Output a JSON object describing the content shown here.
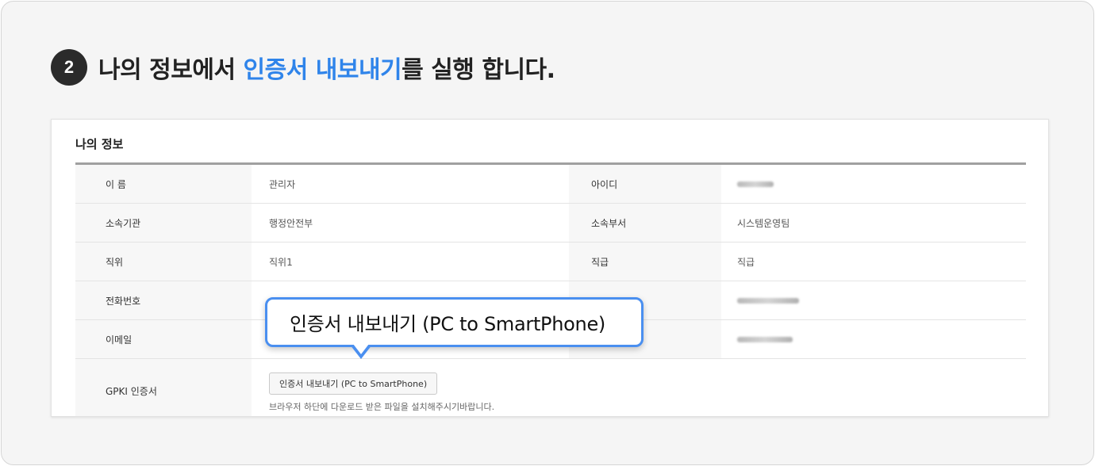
{
  "step": {
    "number": "2",
    "text_before": "나의 정보에서 ",
    "highlight": "인증서 내보내기",
    "text_after": "를 실행 합니다."
  },
  "card": {
    "title": "나의 정보",
    "rows": [
      {
        "label": "이 름",
        "value": "관리자",
        "label2": "아이디",
        "value2": ""
      },
      {
        "label": "소속기관",
        "value": "행정안전부",
        "label2": "소속부서",
        "value2": "시스템운영팀"
      },
      {
        "label": "직위",
        "value": "직위1",
        "label2": "직급",
        "value2": "직급"
      },
      {
        "label": "전화번호",
        "value": "",
        "label2": "",
        "value2": ""
      },
      {
        "label": "이메일",
        "value": "",
        "label2": "",
        "value2": ""
      }
    ],
    "gpki": {
      "label": "GPKI 인증서",
      "button_label": "인증서 내보내기 (PC to SmartPhone)",
      "hint": "브라우저 하단에 다운로드 받은 파일을 설치해주시기바랍니다."
    }
  },
  "tooltip": {
    "text": "인증서 내보내기 (PC to SmartPhone)"
  },
  "colors": {
    "highlight": "#2f84ea",
    "tooltip_border": "#4a8ff0",
    "step_badge": "#2b2b2b"
  }
}
